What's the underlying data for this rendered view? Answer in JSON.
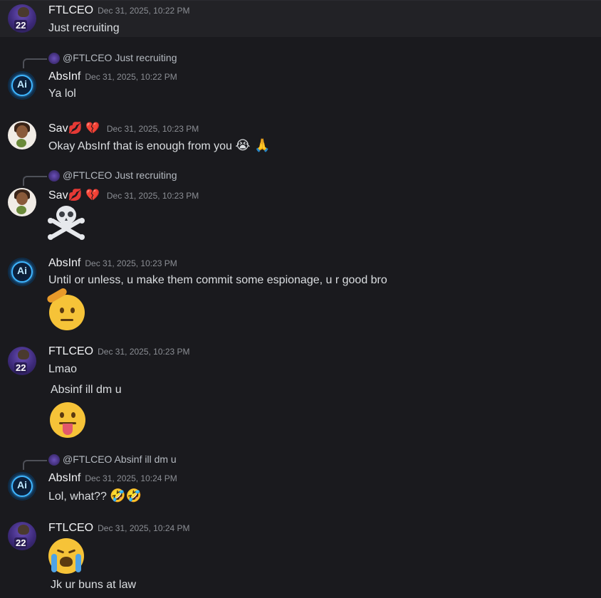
{
  "users": {
    "ftlceo": "FTLCEO",
    "absinf": "AbsInf",
    "sav": "Sav💋 💔"
  },
  "messages": [
    {
      "author": "FTLCEO",
      "time": "Dec 31, 2025, 10:22 PM",
      "text": "Just recruiting"
    },
    {
      "reply_to": "@FTLCEO Just recruiting",
      "author": "AbsInf",
      "time": "Dec 31, 2025, 10:22 PM",
      "text": "Ya lol"
    },
    {
      "author": "Sav💋 💔",
      "time": "Dec 31, 2025, 10:23 PM",
      "text": "Okay AbsInf that is enough from you",
      "emoji": "😭 🙏"
    },
    {
      "reply_to": "@FTLCEO Just recruiting",
      "author": "Sav💋 💔",
      "time": "Dec 31, 2025, 10:23 PM",
      "emoji_name": "skull-crossbones-icon"
    },
    {
      "author": "AbsInf",
      "time": "Dec 31, 2025, 10:23 PM",
      "text": "Until or unless, u make them commit some espionage, u r good bro",
      "emoji_name": "salute-face-icon"
    },
    {
      "author": "FTLCEO",
      "time": "Dec 31, 2025, 10:23 PM",
      "text": "Lmao",
      "text2": "Absinf ill dm u",
      "emoji_name": "tongue-face-icon"
    },
    {
      "reply_to": "@FTLCEO Absinf ill dm u",
      "author": "AbsInf",
      "time": "Dec 31, 2025, 10:24 PM",
      "text": "Lol, what??",
      "emoji": "🤣🤣"
    },
    {
      "author": "FTLCEO",
      "time": "Dec 31, 2025, 10:24 PM",
      "emoji_name": "crying-face-icon",
      "text": "Jk ur buns at law"
    }
  ],
  "avatar_labels": {
    "ftl_number": "22",
    "abs_logo": "Ai"
  },
  "colors": {
    "background": "#1a1a1e",
    "highlight": "#222226",
    "name": "#f2f3f5",
    "timestamp": "#8b8e94"
  }
}
